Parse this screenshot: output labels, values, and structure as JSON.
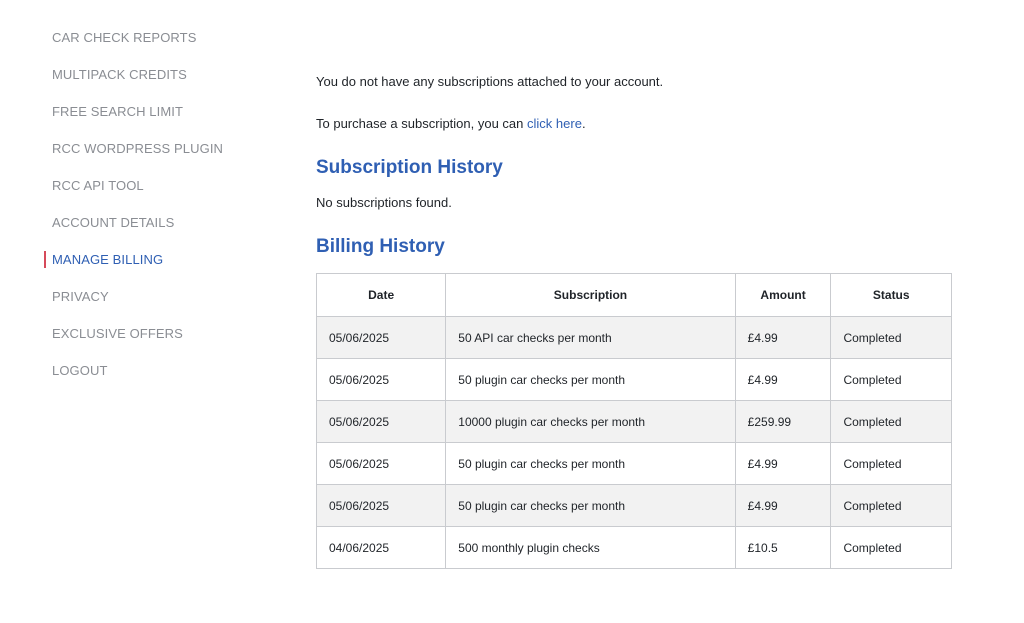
{
  "sidebar": {
    "items": [
      {
        "label": "CAR CHECK REPORTS"
      },
      {
        "label": "MULTIPACK CREDITS"
      },
      {
        "label": "FREE SEARCH LIMIT"
      },
      {
        "label": "RCC WORDPRESS PLUGIN"
      },
      {
        "label": "RCC API TOOL"
      },
      {
        "label": "ACCOUNT DETAILS"
      },
      {
        "label": "MANAGE BILLING",
        "active": true
      },
      {
        "label": "PRIVACY"
      },
      {
        "label": "EXCLUSIVE OFFERS"
      },
      {
        "label": "LOGOUT"
      }
    ]
  },
  "main": {
    "no_subscriptions_text": "You do not have any subscriptions attached to your account.",
    "purchase_text": "To purchase a subscription, you can ",
    "purchase_link": "click here",
    "purchase_suffix": ".",
    "subscription_history_title": "Subscription History",
    "no_subscriptions_found": "No subscriptions found.",
    "billing_history_title": "Billing History",
    "billing_table": {
      "headers": {
        "date": "Date",
        "subscription": "Subscription",
        "amount": "Amount",
        "status": "Status"
      },
      "rows": [
        {
          "date": "05/06/2025",
          "subscription": "50 API car checks per month",
          "amount": "£4.99",
          "status": "Completed"
        },
        {
          "date": "05/06/2025",
          "subscription": "50 plugin car checks per month",
          "amount": "£4.99",
          "status": "Completed"
        },
        {
          "date": "05/06/2025",
          "subscription": "10000 plugin car checks per month",
          "amount": "£259.99",
          "status": "Completed"
        },
        {
          "date": "05/06/2025",
          "subscription": "50 plugin car checks per month",
          "amount": "£4.99",
          "status": "Completed"
        },
        {
          "date": "05/06/2025",
          "subscription": "50 plugin car checks per month",
          "amount": "£4.99",
          "status": "Completed"
        },
        {
          "date": "04/06/2025",
          "subscription": "500 monthly plugin checks",
          "amount": "£10.5",
          "status": "Completed"
        }
      ]
    }
  },
  "colors": {
    "accent": "#2f5fb3",
    "nav_text": "#8a8d93",
    "active_marker": "#d64a5a",
    "row_stripe": "#f2f2f2",
    "border": "#c9cbcf"
  }
}
